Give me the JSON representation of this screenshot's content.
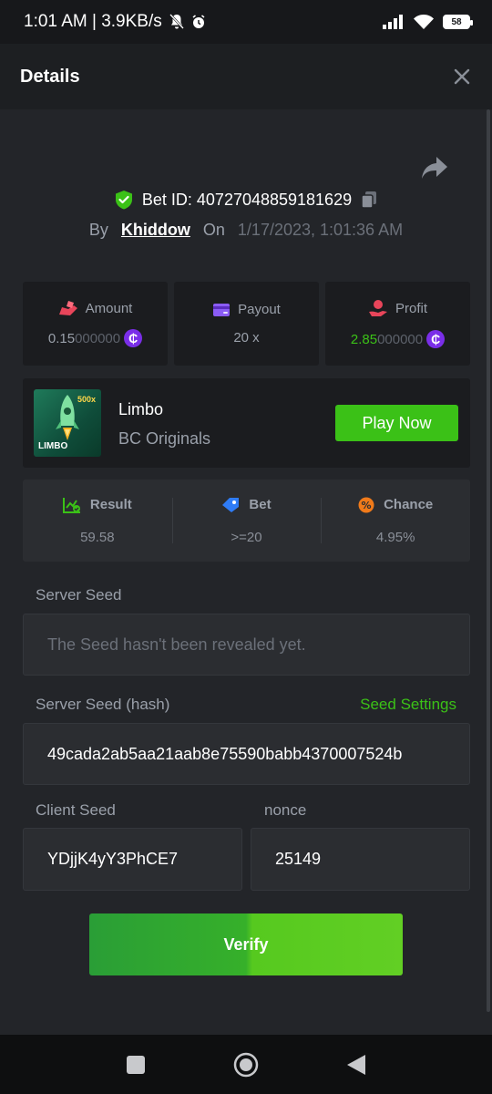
{
  "status_bar": {
    "time_speed": "1:01 AM | 3.9KB/s",
    "battery": "58"
  },
  "header": {
    "title": "Details"
  },
  "bet": {
    "bet_id_label": "Bet ID: 40727048859181629",
    "by_label": "By",
    "user": "Khiddow",
    "on_label": "On",
    "datetime": "1/17/2023, 1:01:36 AM"
  },
  "stats": {
    "amount_label": "Amount",
    "amount_value_main": "0.15",
    "amount_value_dim": "000000",
    "payout_label": "Payout",
    "payout_value": "20 x",
    "profit_label": "Profit",
    "profit_value_main": "2.85",
    "profit_value_dim": "000000"
  },
  "game": {
    "name": "Limbo",
    "provider": "BC Originals",
    "play_label": "Play Now",
    "thumb_badge": "500x",
    "thumb_logo": "LIMBO"
  },
  "result": {
    "result_label": "Result",
    "result_value": "59.58",
    "bet_label": "Bet",
    "bet_value": ">=20",
    "chance_label": "Chance",
    "chance_value": "4.95%"
  },
  "seeds": {
    "server_seed_label": "Server Seed",
    "server_seed_value": "The Seed hasn't been revealed yet.",
    "server_hash_label": "Server Seed (hash)",
    "seed_settings_label": "Seed Settings",
    "server_hash_value": "49cada2ab5aa21aab8e75590babb4370007524b",
    "client_seed_label": "Client Seed",
    "client_seed_value": "YDjjK4yY3PhCE7",
    "nonce_label": "nonce",
    "nonce_value": "25149"
  },
  "verify_label": "Verify",
  "colors": {
    "accent_green": "#3bc117",
    "coin_purple": "#7a2ee8",
    "background": "#232529"
  }
}
